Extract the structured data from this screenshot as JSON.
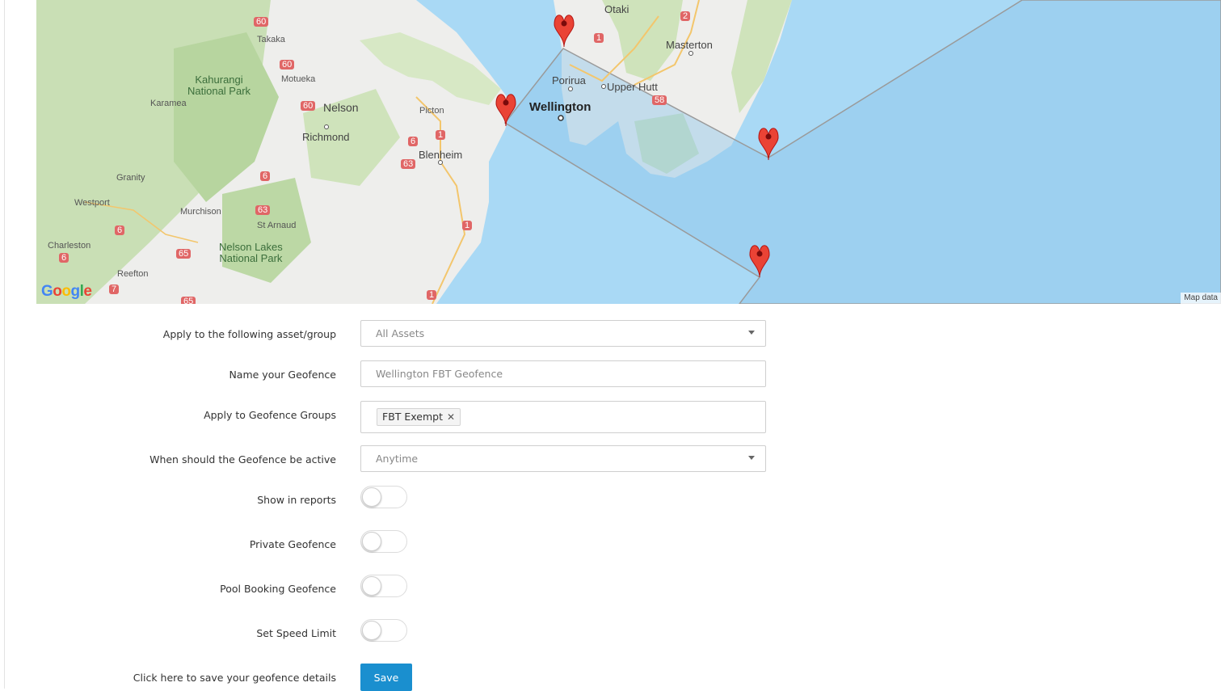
{
  "map": {
    "labels": {
      "otaki": "Otaki",
      "masterton": "Masterton",
      "takaka": "Takaka",
      "kahurangi": "Kahurangi\nNational Park",
      "motueka": "Motueka",
      "karamea": "Karamea",
      "nelson": "Nelson",
      "porirua": "Porirua",
      "upper_hutt": "Upper Hutt",
      "wellington": "Wellington",
      "picton": "Picton",
      "richmond": "Richmond",
      "blenheim": "Blenheim",
      "granity": "Granity",
      "westport": "Westport",
      "murchison": "Murchison",
      "st_arnaud": "St Arnaud",
      "charleston": "Charleston",
      "nelson_lakes": "Nelson Lakes\nNational Park",
      "reefton": "Reefton"
    },
    "road_shields": {
      "s60a": "60",
      "s60b": "60",
      "s60c": "60",
      "s2": "2",
      "s1a": "1",
      "s58": "58",
      "s1b": "1",
      "s6a": "6",
      "s63a": "63",
      "s6b": "6",
      "s63b": "63",
      "s1c": "1",
      "s6c": "6",
      "s6d": "6",
      "s65a": "65",
      "s7": "7",
      "s65b": "65",
      "s1d": "1"
    },
    "google_logo": "Google",
    "attribution": "Map data"
  },
  "form": {
    "asset_label": "Apply to the following asset/group",
    "asset_value": "All Assets",
    "name_label": "Name your Geofence",
    "name_placeholder": "Wellington FBT Geofence",
    "groups_label": "Apply to Geofence Groups",
    "groups_tag": "FBT Exempt",
    "groups_tag_remove": "✕",
    "active_label": "When should the Geofence be active",
    "active_value": "Anytime",
    "show_reports_label": "Show in reports",
    "private_label": "Private Geofence",
    "pool_label": "Pool Booking Geofence",
    "speed_label": "Set Speed Limit",
    "save_hint_label": "Click here to save your geofence details",
    "save_button": "Save"
  },
  "toggles": {
    "show_in_reports": false,
    "private_geofence": false,
    "pool_booking_geofence": false,
    "set_speed_limit": false
  },
  "colors": {
    "sea": "#a9d9f5",
    "land": "#eeeeec",
    "forest": "#c9dfb5",
    "geofence_fill": "#9cc8e6",
    "marker": "#ea4335",
    "save_button": "#1a8fcf"
  }
}
